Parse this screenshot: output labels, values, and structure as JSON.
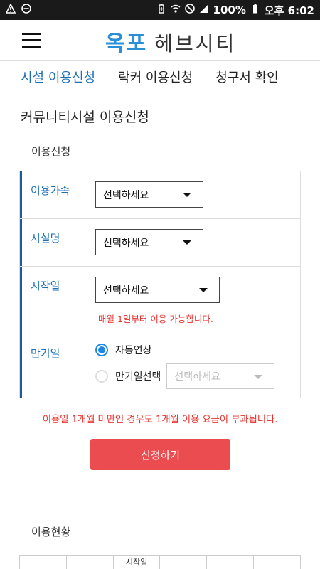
{
  "status_bar": {
    "battery": "100%",
    "time": "오후 6:02"
  },
  "header": {
    "logo_part1": "옥포",
    "logo_part2": "헤브시티"
  },
  "tabs": [
    {
      "label": "시설 이용신청",
      "active": true
    },
    {
      "label": "락커 이용신청",
      "active": false
    },
    {
      "label": "청구서 확인",
      "active": false
    }
  ],
  "page_title": "커뮤니티시설 이용신청",
  "apply_section": {
    "title": "이용신청",
    "rows": {
      "family": {
        "label": "이용가족",
        "select": "선택하세요"
      },
      "facility": {
        "label": "시설명",
        "select": "선택하세요"
      },
      "start": {
        "label": "시작일",
        "select": "선택하세요",
        "note": "매월 1일부터 이용 가능합니다."
      },
      "expiry": {
        "label": "만기일",
        "radio_auto": "자동연장",
        "radio_select": "만기일선택",
        "select": "선택하세요"
      }
    },
    "warning": "이용일 1개월 미만인 경우도 1개월 이용 요금이 부과됩니다.",
    "submit_label": "신청하기"
  },
  "status_section": {
    "title": "이용현황",
    "partial_header": "시작일"
  },
  "colors": {
    "accent_blue": "#1d6fb8",
    "button_red": "#ea4c50",
    "warning_red": "#e8322e"
  }
}
